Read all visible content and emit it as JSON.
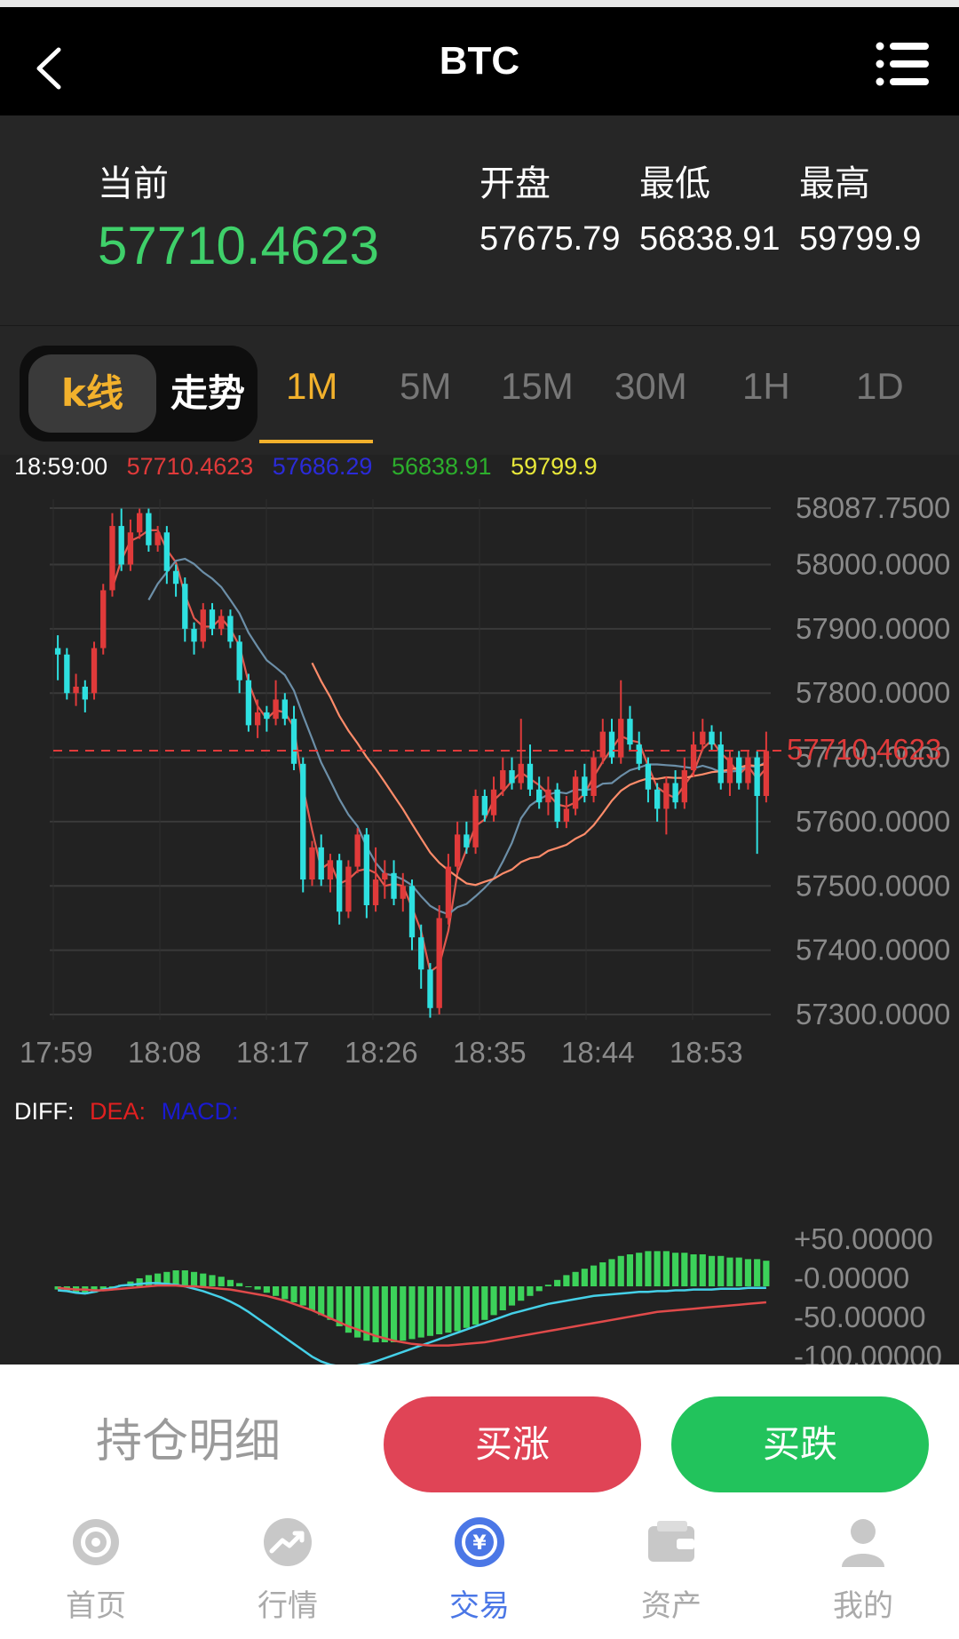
{
  "header": {
    "title": "BTC"
  },
  "quote": {
    "current_label": "当前",
    "current_value": "57710.4623",
    "open_label": "开盘",
    "open_value": "57675.79",
    "low_label": "最低",
    "low_value": "56838.91",
    "high_label": "最高",
    "high_value": "59799.9"
  },
  "tabs": {
    "kline": "k线",
    "trend": "走势",
    "periods": [
      "1M",
      "5M",
      "15M",
      "30M",
      "1H",
      "1D"
    ],
    "active_period": "1M"
  },
  "legend": {
    "time": "18:59:00",
    "v1": "57710.4623",
    "v2": "57686.29",
    "v3": "56838.91",
    "v4": "59799.9"
  },
  "macd_legend": {
    "diff": "DIFF:",
    "dea": "DEA:",
    "macd": "MACD:"
  },
  "chart_data": {
    "type": "candlestick",
    "title": "",
    "x_ticks": [
      "17:59",
      "18:08",
      "18:17",
      "18:26",
      "18:35",
      "18:44",
      "18:53"
    ],
    "y_ticks": [
      "58087.7500",
      "58000.0000",
      "57900.0000",
      "57800.0000",
      "57700.0000",
      "57600.0000",
      "57500.0000",
      "57400.0000",
      "57300.0000"
    ],
    "current_price_label": "57710.4623",
    "ylim": [
      57300,
      58087.75
    ],
    "candles": [
      {
        "o": 57870,
        "c": 57860,
        "h": 57890,
        "l": 57820
      },
      {
        "o": 57860,
        "c": 57800,
        "h": 57870,
        "l": 57790
      },
      {
        "o": 57800,
        "c": 57810,
        "h": 57830,
        "l": 57780
      },
      {
        "o": 57810,
        "c": 57790,
        "h": 57820,
        "l": 57770
      },
      {
        "o": 57800,
        "c": 57870,
        "h": 57880,
        "l": 57790
      },
      {
        "o": 57870,
        "c": 57960,
        "h": 57970,
        "l": 57860
      },
      {
        "o": 57960,
        "c": 58060,
        "h": 58080,
        "l": 57950
      },
      {
        "o": 58060,
        "c": 58000,
        "h": 58087,
        "l": 57990
      },
      {
        "o": 58000,
        "c": 58050,
        "h": 58070,
        "l": 57990
      },
      {
        "o": 58050,
        "c": 58080,
        "h": 58087,
        "l": 58040
      },
      {
        "o": 58080,
        "c": 58030,
        "h": 58087,
        "l": 58020
      },
      {
        "o": 58030,
        "c": 58050,
        "h": 58060,
        "l": 58020
      },
      {
        "o": 58050,
        "c": 57990,
        "h": 58060,
        "l": 57970
      },
      {
        "o": 57990,
        "c": 57970,
        "h": 58000,
        "l": 57950
      },
      {
        "o": 57970,
        "c": 57900,
        "h": 57980,
        "l": 57880
      },
      {
        "o": 57900,
        "c": 57880,
        "h": 57910,
        "l": 57860
      },
      {
        "o": 57880,
        "c": 57930,
        "h": 57940,
        "l": 57870
      },
      {
        "o": 57930,
        "c": 57900,
        "h": 57940,
        "l": 57890
      },
      {
        "o": 57900,
        "c": 57920,
        "h": 57930,
        "l": 57890
      },
      {
        "o": 57920,
        "c": 57880,
        "h": 57930,
        "l": 57870
      },
      {
        "o": 57880,
        "c": 57820,
        "h": 57890,
        "l": 57800
      },
      {
        "o": 57820,
        "c": 57750,
        "h": 57830,
        "l": 57740
      },
      {
        "o": 57750,
        "c": 57770,
        "h": 57790,
        "l": 57730
      },
      {
        "o": 57770,
        "c": 57760,
        "h": 57780,
        "l": 57740
      },
      {
        "o": 57760,
        "c": 57790,
        "h": 57820,
        "l": 57750
      },
      {
        "o": 57790,
        "c": 57760,
        "h": 57800,
        "l": 57750
      },
      {
        "o": 57760,
        "c": 57690,
        "h": 57780,
        "l": 57680
      },
      {
        "o": 57690,
        "c": 57510,
        "h": 57700,
        "l": 57490
      },
      {
        "o": 57510,
        "c": 57560,
        "h": 57570,
        "l": 57500
      },
      {
        "o": 57560,
        "c": 57510,
        "h": 57580,
        "l": 57500
      },
      {
        "o": 57510,
        "c": 57540,
        "h": 57550,
        "l": 57490
      },
      {
        "o": 57540,
        "c": 57460,
        "h": 57550,
        "l": 57440
      },
      {
        "o": 57460,
        "c": 57530,
        "h": 57540,
        "l": 57450
      },
      {
        "o": 57530,
        "c": 57580,
        "h": 57590,
        "l": 57520
      },
      {
        "o": 57580,
        "c": 57470,
        "h": 57590,
        "l": 57450
      },
      {
        "o": 57470,
        "c": 57510,
        "h": 57560,
        "l": 57460
      },
      {
        "o": 57510,
        "c": 57520,
        "h": 57540,
        "l": 57480
      },
      {
        "o": 57520,
        "c": 57480,
        "h": 57540,
        "l": 57470
      },
      {
        "o": 57480,
        "c": 57500,
        "h": 57520,
        "l": 57460
      },
      {
        "o": 57500,
        "c": 57420,
        "h": 57510,
        "l": 57400
      },
      {
        "o": 57420,
        "c": 57370,
        "h": 57440,
        "l": 57340
      },
      {
        "o": 57370,
        "c": 57310,
        "h": 57380,
        "l": 57295
      },
      {
        "o": 57310,
        "c": 57450,
        "h": 57470,
        "l": 57300
      },
      {
        "o": 57450,
        "c": 57530,
        "h": 57550,
        "l": 57440
      },
      {
        "o": 57530,
        "c": 57580,
        "h": 57600,
        "l": 57520
      },
      {
        "o": 57580,
        "c": 57560,
        "h": 57600,
        "l": 57550
      },
      {
        "o": 57560,
        "c": 57640,
        "h": 57650,
        "l": 57550
      },
      {
        "o": 57640,
        "c": 57610,
        "h": 57650,
        "l": 57600
      },
      {
        "o": 57610,
        "c": 57650,
        "h": 57670,
        "l": 57600
      },
      {
        "o": 57650,
        "c": 57680,
        "h": 57700,
        "l": 57640
      },
      {
        "o": 57680,
        "c": 57660,
        "h": 57700,
        "l": 57650
      },
      {
        "o": 57660,
        "c": 57690,
        "h": 57760,
        "l": 57650
      },
      {
        "o": 57690,
        "c": 57650,
        "h": 57720,
        "l": 57640
      },
      {
        "o": 57650,
        "c": 57630,
        "h": 57670,
        "l": 57620
      },
      {
        "o": 57630,
        "c": 57650,
        "h": 57670,
        "l": 57610
      },
      {
        "o": 57650,
        "c": 57600,
        "h": 57660,
        "l": 57590
      },
      {
        "o": 57600,
        "c": 57620,
        "h": 57640,
        "l": 57590
      },
      {
        "o": 57620,
        "c": 57670,
        "h": 57680,
        "l": 57610
      },
      {
        "o": 57670,
        "c": 57640,
        "h": 57690,
        "l": 57630
      },
      {
        "o": 57640,
        "c": 57700,
        "h": 57710,
        "l": 57630
      },
      {
        "o": 57700,
        "c": 57740,
        "h": 57760,
        "l": 57690
      },
      {
        "o": 57740,
        "c": 57700,
        "h": 57760,
        "l": 57690
      },
      {
        "o": 57700,
        "c": 57760,
        "h": 57820,
        "l": 57690
      },
      {
        "o": 57760,
        "c": 57720,
        "h": 57780,
        "l": 57710
      },
      {
        "o": 57720,
        "c": 57690,
        "h": 57740,
        "l": 57680
      },
      {
        "o": 57690,
        "c": 57650,
        "h": 57700,
        "l": 57630
      },
      {
        "o": 57650,
        "c": 57620,
        "h": 57660,
        "l": 57600
      },
      {
        "o": 57620,
        "c": 57660,
        "h": 57670,
        "l": 57580
      },
      {
        "o": 57660,
        "c": 57630,
        "h": 57680,
        "l": 57620
      },
      {
        "o": 57630,
        "c": 57680,
        "h": 57700,
        "l": 57620
      },
      {
        "o": 57680,
        "c": 57720,
        "h": 57740,
        "l": 57670
      },
      {
        "o": 57720,
        "c": 57740,
        "h": 57760,
        "l": 57710
      },
      {
        "o": 57740,
        "c": 57720,
        "h": 57750,
        "l": 57710
      },
      {
        "o": 57720,
        "c": 57660,
        "h": 57740,
        "l": 57650
      },
      {
        "o": 57660,
        "c": 57700,
        "h": 57710,
        "l": 57640
      },
      {
        "o": 57700,
        "c": 57660,
        "h": 57710,
        "l": 57650
      },
      {
        "o": 57660,
        "c": 57700,
        "h": 57710,
        "l": 57650
      },
      {
        "o": 57700,
        "c": 57640,
        "h": 57710,
        "l": 57550
      },
      {
        "o": 57640,
        "c": 57710,
        "h": 57740,
        "l": 57630
      }
    ],
    "macd_y_ticks": [
      "+50.00000",
      "-0.00000",
      "-50.00000",
      "-100.00000"
    ],
    "macd_hist": [
      -4,
      -6,
      -8,
      -10,
      -8,
      -6,
      -4,
      2,
      6,
      10,
      14,
      16,
      18,
      20,
      20,
      18,
      16,
      14,
      12,
      8,
      4,
      0,
      -4,
      -8,
      -12,
      -16,
      -20,
      -24,
      -30,
      -36,
      -42,
      -50,
      -58,
      -64,
      -68,
      -70,
      -70,
      -70,
      -68,
      -66,
      -64,
      -62,
      -60,
      -58,
      -56,
      -52,
      -48,
      -42,
      -36,
      -30,
      -24,
      -18,
      -12,
      -6,
      2,
      8,
      14,
      18,
      22,
      26,
      30,
      34,
      38,
      40,
      42,
      44,
      44,
      44,
      42,
      42,
      40,
      40,
      38,
      38,
      36,
      36,
      34,
      34,
      32
    ],
    "macd_diff": [
      -5,
      -6,
      -8,
      -9,
      -7,
      -4,
      -2,
      1,
      2,
      3,
      4,
      4,
      3,
      2,
      0,
      -3,
      -6,
      -10,
      -14,
      -19,
      -25,
      -32,
      -40,
      -48,
      -56,
      -64,
      -72,
      -80,
      -88,
      -94,
      -98,
      -100,
      -100,
      -99,
      -97,
      -94,
      -90,
      -86,
      -82,
      -78,
      -74,
      -70,
      -66,
      -62,
      -58,
      -54,
      -50,
      -46,
      -42,
      -38,
      -34,
      -31,
      -28,
      -25,
      -22,
      -20,
      -18,
      -16,
      -14,
      -12,
      -11,
      -10,
      -9,
      -8,
      -7,
      -7,
      -6,
      -6,
      -5,
      -5,
      -4,
      -4,
      -4,
      -3,
      -3,
      -3,
      -2,
      -2,
      -2
    ],
    "macd_dea": [
      -2,
      -3,
      -4,
      -4,
      -5,
      -5,
      -4,
      -3,
      -2,
      -1,
      0,
      1,
      1,
      1,
      0,
      0,
      -1,
      -2,
      -3,
      -4,
      -6,
      -8,
      -10,
      -12,
      -15,
      -18,
      -22,
      -26,
      -30,
      -35,
      -40,
      -45,
      -50,
      -54,
      -58,
      -62,
      -65,
      -68,
      -70,
      -72,
      -73,
      -74,
      -74,
      -74,
      -73,
      -72,
      -71,
      -70,
      -68,
      -66,
      -64,
      -62,
      -60,
      -58,
      -56,
      -54,
      -52,
      -50,
      -48,
      -46,
      -44,
      -42,
      -40,
      -38,
      -36,
      -34,
      -32,
      -31,
      -30,
      -29,
      -28,
      -27,
      -26,
      -25,
      -24,
      -23,
      -22,
      -21,
      -20
    ],
    "colors": {
      "up": "#e03a3a",
      "down": "#2ee0e0",
      "hist": "#3cd25a",
      "ma1": "#ff8c6a",
      "ma2": "#6c8fa8",
      "ma3": "#e2584e"
    }
  },
  "action": {
    "hold": "持仓明细",
    "buy_up": "买涨",
    "buy_down": "买跌"
  },
  "nav": [
    {
      "label": "首页",
      "icon": "home-target-icon"
    },
    {
      "label": "行情",
      "icon": "market-trend-icon"
    },
    {
      "label": "交易",
      "icon": "trade-yuan-icon"
    },
    {
      "label": "资产",
      "icon": "wallet-icon"
    },
    {
      "label": "我的",
      "icon": "user-icon"
    }
  ],
  "nav_active": 2,
  "colors": {
    "green": "#3fd06a",
    "gold": "#f2b12c",
    "red_btn": "#e04456",
    "green_btn": "#22c35c",
    "nav_active": "#4b77e6"
  }
}
